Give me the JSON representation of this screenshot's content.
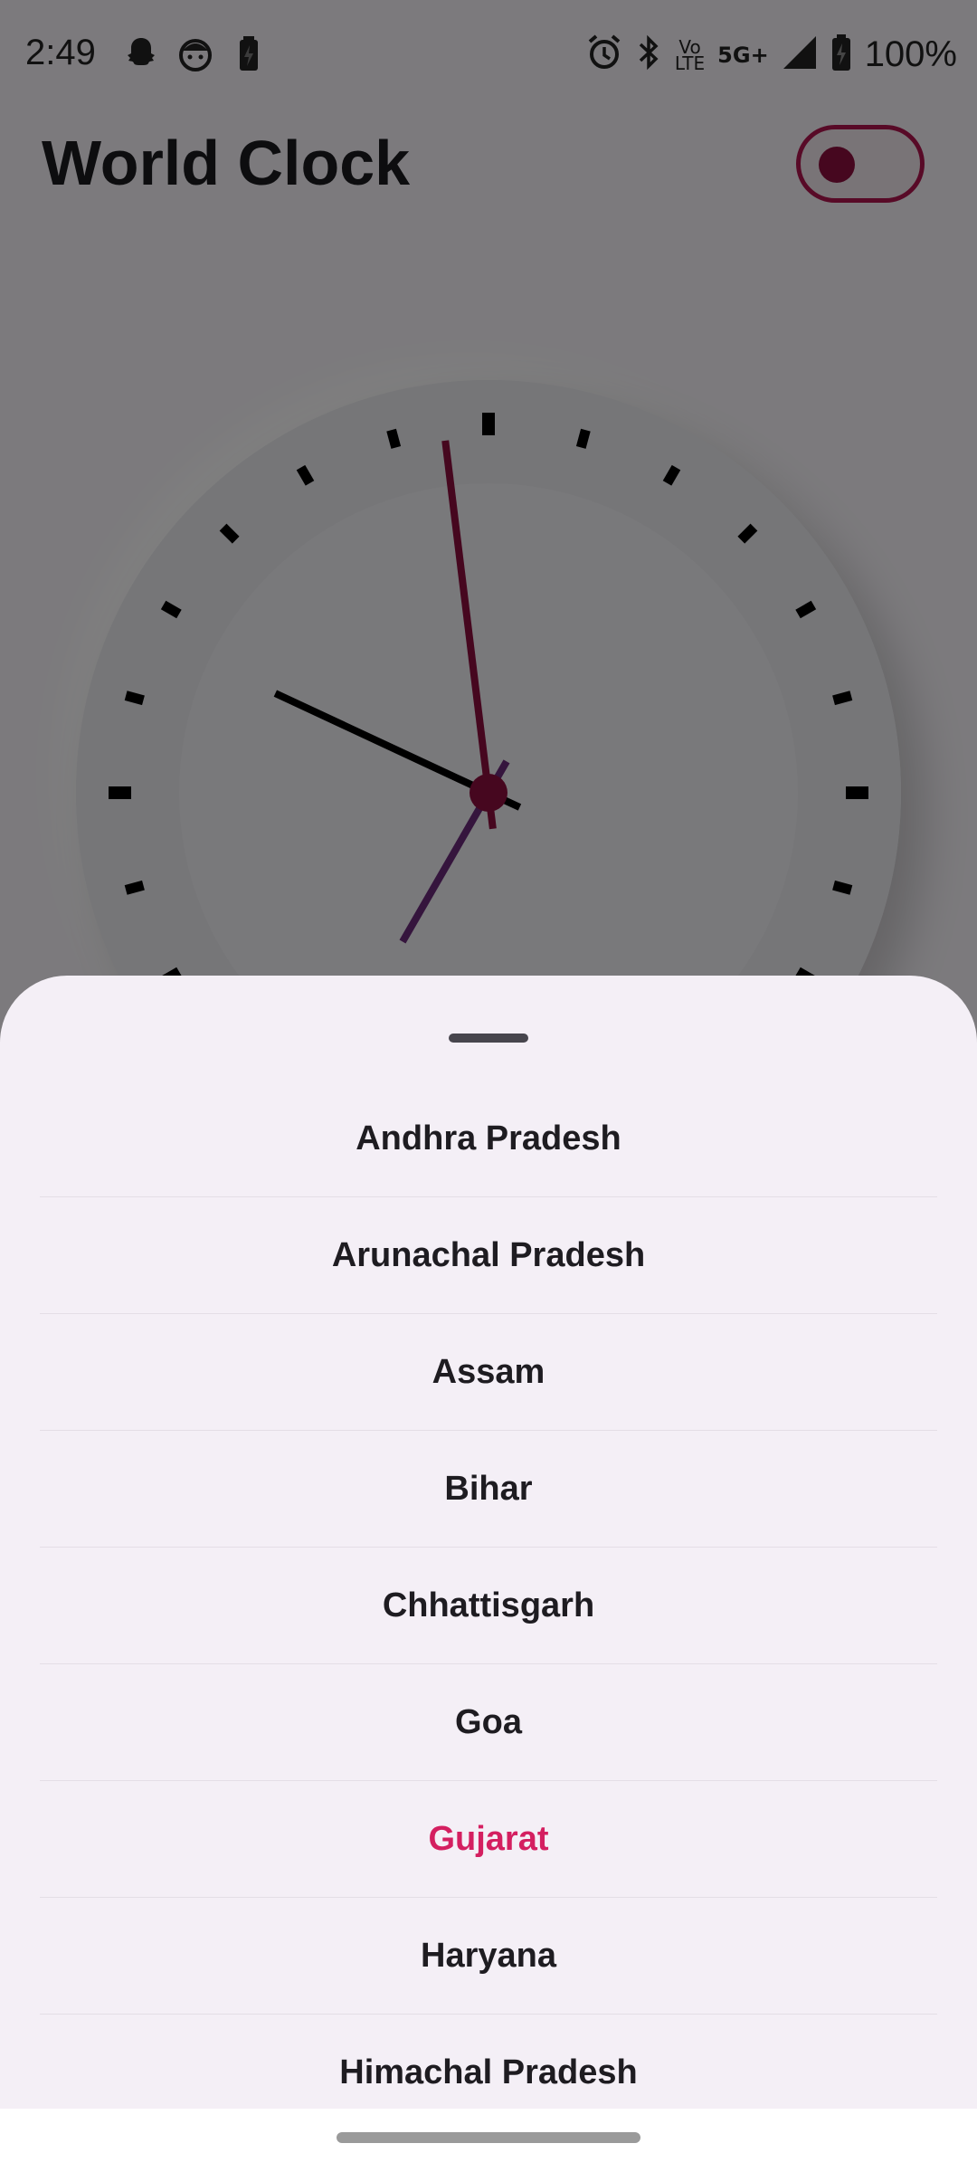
{
  "status_bar": {
    "time": "2:49",
    "battery": "100%",
    "network": "5G+",
    "volte_top": "Vo",
    "volte_bottom": "LTE",
    "icons": [
      "snapchat-icon",
      "face-icon",
      "battery-saver-icon",
      "alarm-icon",
      "bluetooth-icon",
      "volte-icon",
      "5g-icon",
      "signal-icon",
      "battery-icon"
    ]
  },
  "header": {
    "title": "World Clock",
    "theme_toggle_state": "on"
  },
  "clock": {
    "hour_hand_angle_deg": -65,
    "minute_hand_angle_deg": -7,
    "second_hand_angle_deg": 210,
    "colors": {
      "face": "#efeef3",
      "tick": "#000000",
      "hour_hand": "#000000",
      "minute_hand": "#8d0f3f",
      "second_hand": "#6a2a7a",
      "center": "#8d0f3f"
    }
  },
  "sheet": {
    "states": [
      {
        "label": "Andhra Pradesh",
        "selected": false
      },
      {
        "label": "Arunachal Pradesh",
        "selected": false
      },
      {
        "label": "Assam",
        "selected": false
      },
      {
        "label": "Bihar",
        "selected": false
      },
      {
        "label": "Chhattisgarh",
        "selected": false
      },
      {
        "label": "Goa",
        "selected": false
      },
      {
        "label": "Gujarat",
        "selected": true
      },
      {
        "label": "Haryana",
        "selected": false
      },
      {
        "label": "Himachal Pradesh",
        "selected": false
      }
    ],
    "accent_color": "#d41f60"
  }
}
